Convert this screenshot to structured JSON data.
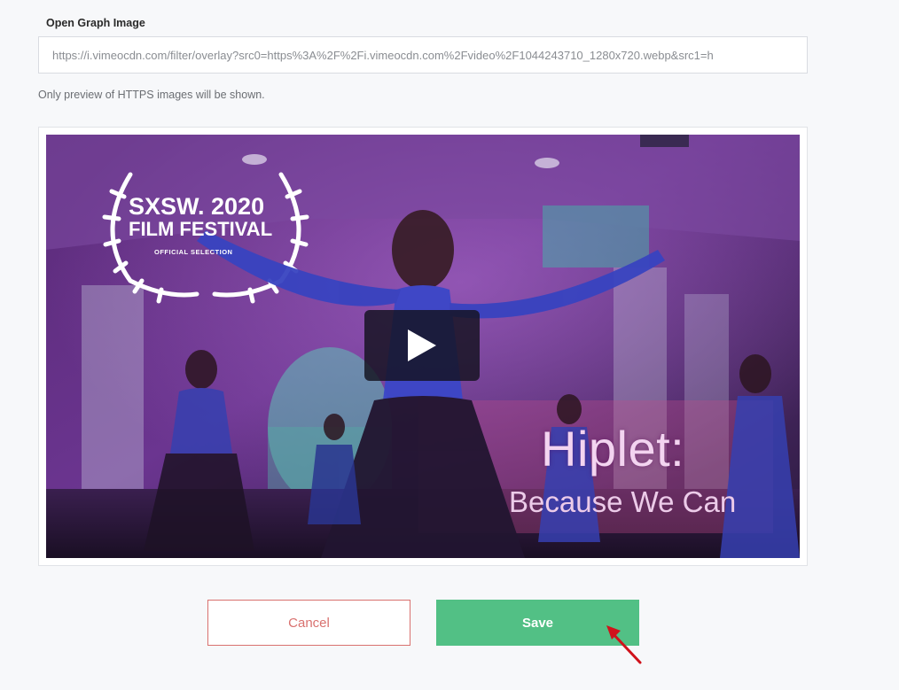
{
  "form": {
    "og_image_label": "Open Graph Image",
    "og_image_url": "https://i.vimeocdn.com/filter/overlay?src0=https%3A%2F%2Fi.vimeocdn.com%2Fvideo%2F1044243710_1280x720.webp&src1=h",
    "https_hint": "Only preview of HTTPS images will be shown."
  },
  "preview": {
    "laurel_line1": "SXSW. 2020",
    "laurel_line2": "FILM FESTIVAL",
    "laurel_line3": "OFFICIAL SELECTION",
    "title": "Hiplet:",
    "subtitle": "Because We Can"
  },
  "actions": {
    "cancel_label": "Cancel",
    "save_label": "Save"
  },
  "colors": {
    "save": "#52c085",
    "cancel": "#d9716f",
    "annotation_arrow": "#d0121b"
  },
  "icons": {
    "play": "play-icon",
    "laurel": "laurel-wreath-icon",
    "arrow": "annotation-arrow-icon"
  }
}
